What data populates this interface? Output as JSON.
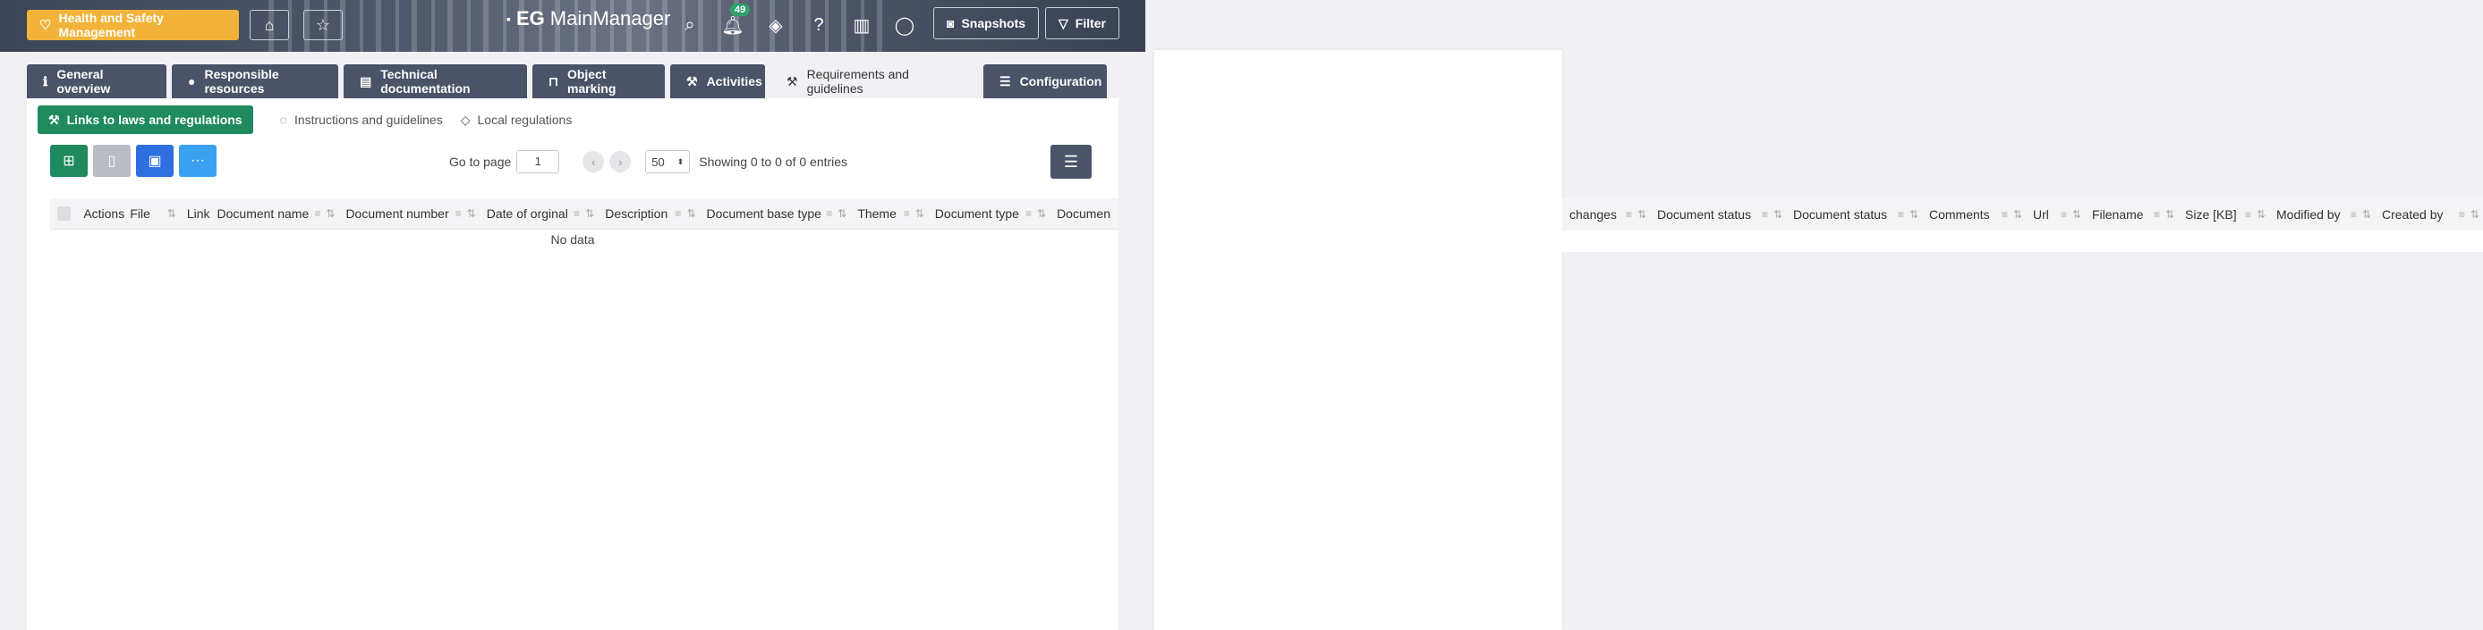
{
  "header": {
    "module_button": "Health and Safety Management",
    "app_name_bold": "EG",
    "app_name": "MainManager",
    "notification_count": "49",
    "snapshots_label": "Snapshots",
    "filter_label": "Filter"
  },
  "tabs": [
    {
      "label": "General overview",
      "icon": "info-icon"
    },
    {
      "label": "Responsible resources",
      "icon": "person-icon"
    },
    {
      "label": "Technical documentation",
      "icon": "document-icon"
    },
    {
      "label": "Object marking",
      "icon": "marking-icon"
    },
    {
      "label": "Activities",
      "icon": "wrench-icon"
    },
    {
      "label": "Requirements and guidelines",
      "icon": "hammer-icon",
      "active": true
    },
    {
      "label": "Configuration",
      "icon": "sliders-icon"
    }
  ],
  "subtabs": [
    {
      "label": "Links to laws and regulations",
      "active": true
    },
    {
      "label": "Instructions and guidelines"
    },
    {
      "label": "Local regulations"
    }
  ],
  "toolbar": {
    "colors": {
      "new": "#1e8a5e",
      "disabled": "#b9bcc2",
      "pdf": "#2f6fe0",
      "more": "#3aa0f0"
    }
  },
  "pager": {
    "goto_label": "Go to page",
    "page_value": "1",
    "page_size": "50",
    "showing": "Showing 0 to 0 of 0 entries"
  },
  "table": {
    "columns_left": [
      "Actions",
      "File",
      "Link",
      "Document name",
      "Document number",
      "Date of orginal",
      "Description",
      "Document base type",
      "Theme",
      "Document type",
      "Documen"
    ],
    "columns_right": [
      "changes",
      "Document status",
      "Document status",
      "Comments",
      "Url",
      "Filename",
      "Size [KB]",
      "Modified by",
      "Created by"
    ],
    "empty_text": "No data"
  },
  "colors": {
    "accent": "#f2b33a",
    "tab_bg": "#4a5368",
    "green": "#1e8a5e"
  }
}
